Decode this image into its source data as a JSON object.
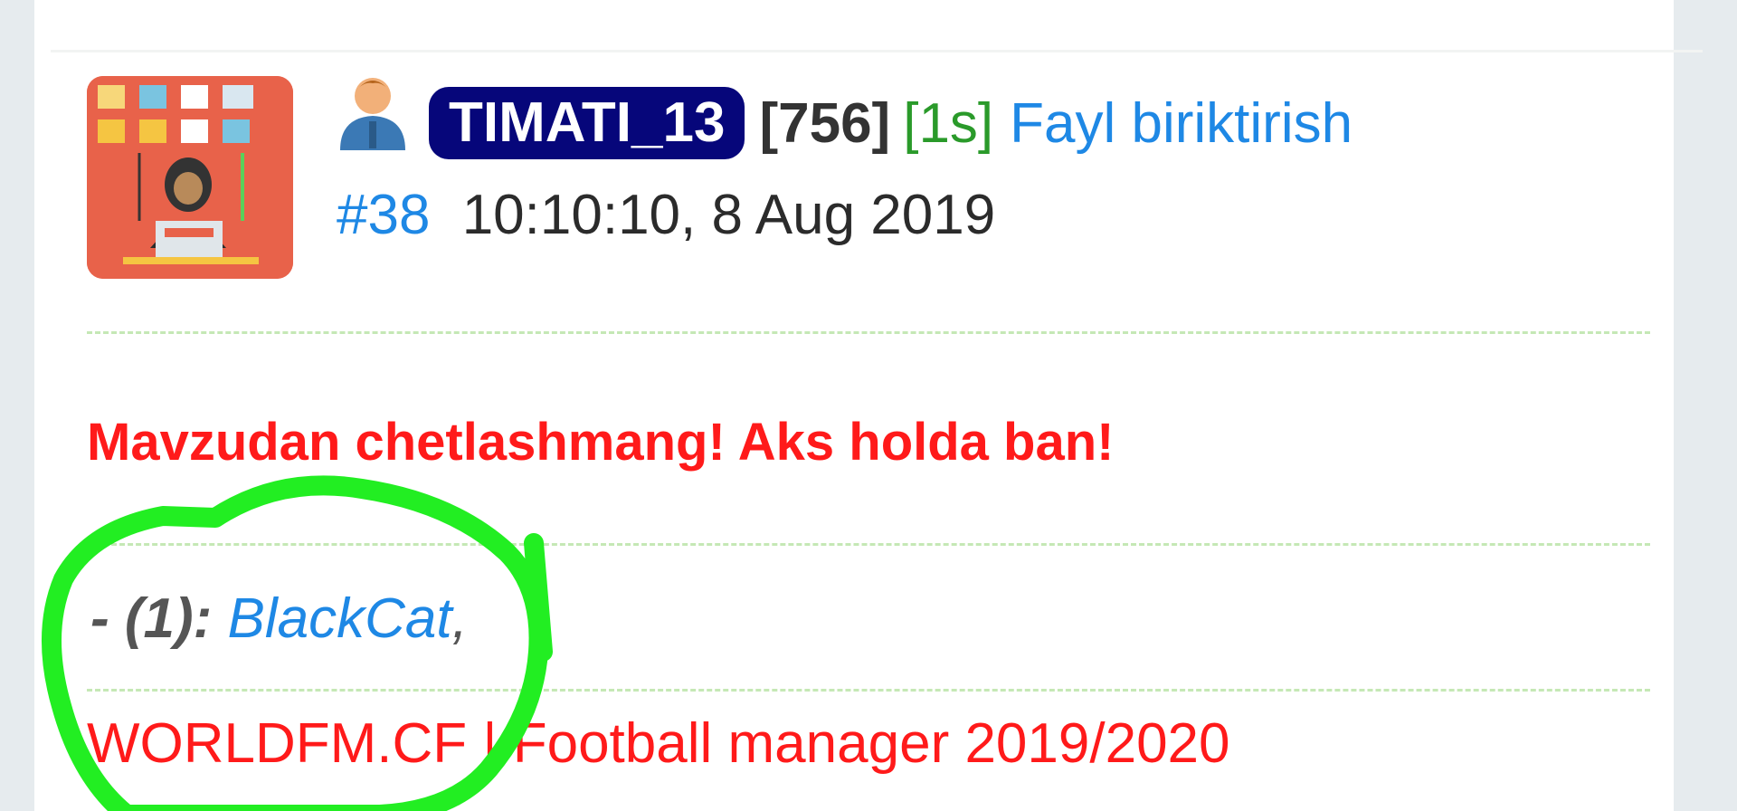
{
  "post": {
    "username": "TIMATI_13",
    "rating": "[756]",
    "online": "[1s]",
    "attach_link": "Fayl biriktirish",
    "post_number": "#38",
    "timestamp": "10:10:10, 8 Aug 2019",
    "warning": "Mavzudan chetlashmang! Aks holda ban!",
    "likes": {
      "prefix": "- (1):",
      "user": "BlackCat",
      "separator": ","
    },
    "signature": "WORLDFM.CF | Football manager 2019/2020"
  },
  "colors": {
    "link": "#1e88e5",
    "warning": "#ff1a1a",
    "online": "#2a9a2a",
    "username_bg": "#06067a",
    "highlight_circle": "#22ee22"
  },
  "icons": {
    "avatar": "avatar-image",
    "user_status": "user-icon"
  }
}
